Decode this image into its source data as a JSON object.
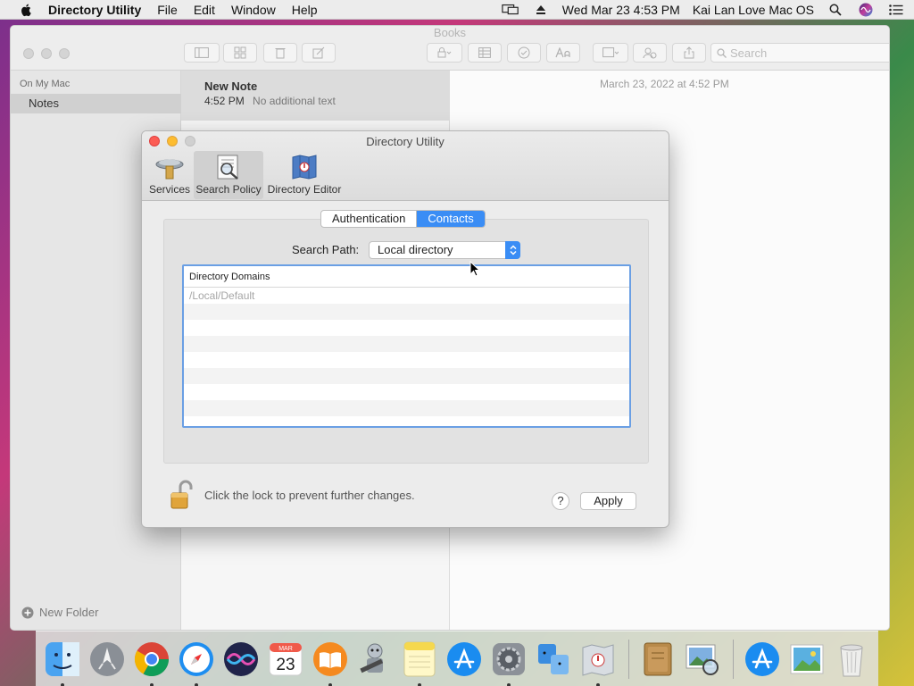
{
  "menubar": {
    "app_name": "Directory Utility",
    "menus": [
      "File",
      "Edit",
      "Window",
      "Help"
    ],
    "clock": "Wed Mar 23  4:53 PM",
    "user_name": "Kai Lan Love Mac OS"
  },
  "notes_window": {
    "title": "Books",
    "search_placeholder": "Search",
    "sidebar_header": "On My Mac",
    "sidebar_item": "Notes",
    "new_folder_label": "New Folder",
    "note": {
      "title": "New Note",
      "time": "4:52 PM",
      "preview": "No additional text"
    },
    "note_date": "March 23, 2022 at 4:52 PM"
  },
  "directory_utility": {
    "title": "Directory Utility",
    "toolbar": {
      "services": "Services",
      "search_policy": "Search Policy",
      "directory_editor": "Directory Editor"
    },
    "tabs": {
      "authentication": "Authentication",
      "contacts": "Contacts",
      "active": "Contacts"
    },
    "search_path_label": "Search Path:",
    "search_path_value": "Local directory",
    "table": {
      "header": "Directory Domains",
      "rows": [
        "/Local/Default"
      ]
    },
    "lock_text": "Click the lock to prevent further changes.",
    "help_label": "?",
    "apply_label": "Apply"
  },
  "colors": {
    "accent": "#3a8df5",
    "close": "#fc5c54",
    "minimize": "#fdbc2f"
  },
  "dock": {
    "items": [
      "finder-icon",
      "launchpad-icon",
      "chrome-icon",
      "safari-icon",
      "siri-icon",
      "calendar-icon",
      "books-icon",
      "automator-icon",
      "notes-icon",
      "app-store-icon",
      "system-preferences-icon",
      "migration-assistant-icon",
      "directory-utility-icon",
      "contacts-archive-icon",
      "preview-icon",
      "app-store-folder-icon",
      "photos-icon",
      "trash-icon"
    ],
    "calendar_month": "MAR",
    "calendar_day": "23"
  }
}
